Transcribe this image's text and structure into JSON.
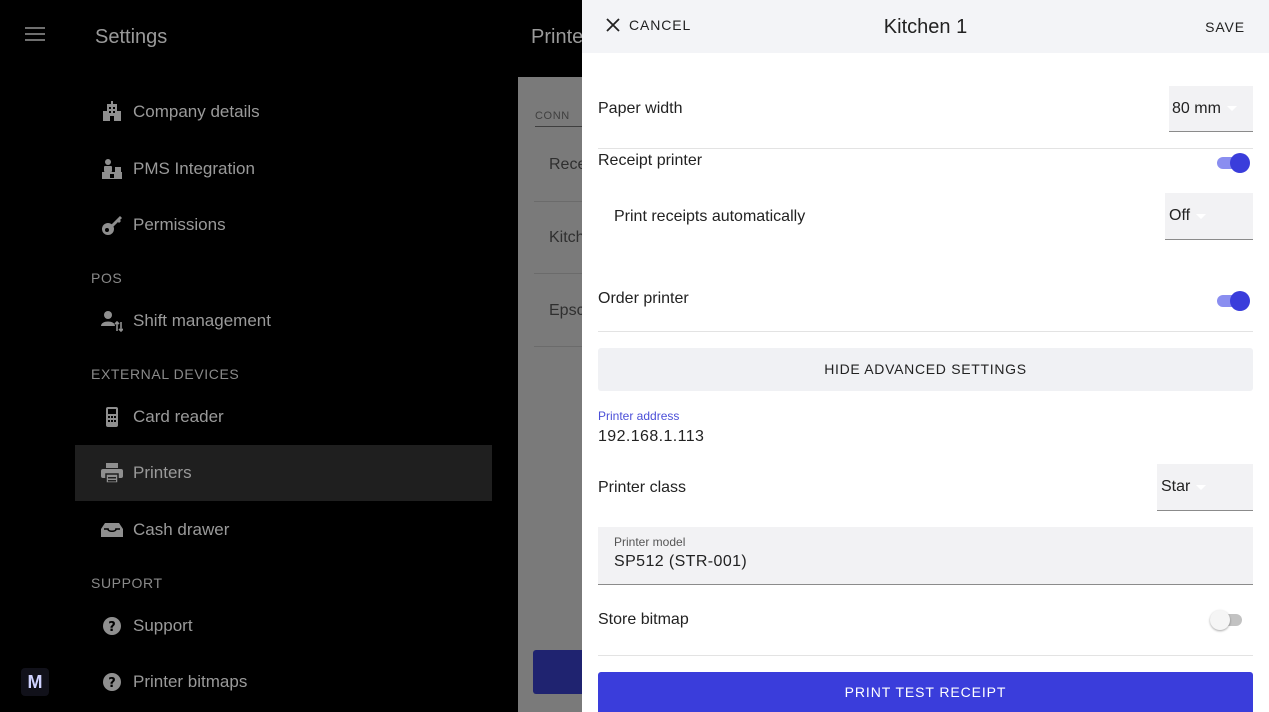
{
  "rail": {
    "logo_letter": "M"
  },
  "sidebar": {
    "title": "Settings",
    "sections": {
      "pos": "POS",
      "external_devices": "EXTERNAL DEVICES",
      "support": "SUPPORT"
    },
    "items": [
      {
        "label": "Company details",
        "icon": "building-icon"
      },
      {
        "label": "PMS Integration",
        "icon": "hotel-icon"
      },
      {
        "label": "Permissions",
        "icon": "key-icon"
      },
      {
        "label": "Shift management",
        "icon": "shift-users-icon"
      },
      {
        "label": "Card reader",
        "icon": "card-reader-icon"
      },
      {
        "label": "Printers",
        "icon": "printer-icon"
      },
      {
        "label": "Cash drawer",
        "icon": "cash-drawer-icon"
      },
      {
        "label": "Support",
        "icon": "help-icon"
      },
      {
        "label": "Printer bitmaps",
        "icon": "help-icon"
      }
    ],
    "active_item": "Printers"
  },
  "middle": {
    "title": "Printe",
    "tab": "CONN",
    "rows": [
      "Rece",
      "Kitch",
      "Epsc"
    ]
  },
  "dialog": {
    "cancel_label": "CANCEL",
    "title": "Kitchen 1",
    "save_label": "SAVE",
    "paper_width": {
      "label": "Paper width",
      "value": "80 mm"
    },
    "receipt_printer": {
      "label": "Receipt printer",
      "on": true
    },
    "print_receipts_auto": {
      "label": "Print receipts automatically",
      "value": "Off"
    },
    "order_printer": {
      "label": "Order printer",
      "on": true
    },
    "advanced_button": "HIDE ADVANCED SETTINGS",
    "printer_address": {
      "label": "Printer address",
      "value": "192.168.1.113"
    },
    "printer_class": {
      "label": "Printer class",
      "value": "Star"
    },
    "printer_model": {
      "label": "Printer model",
      "value": "SP512 (STR-001)"
    },
    "store_bitmap": {
      "label": "Store bitmap",
      "on": false
    },
    "print_test_button": "PRINT TEST RECEIPT"
  },
  "colors": {
    "accent": "#3a3ddb",
    "accent_light": "#8a8ef0",
    "float_label": "#4b4fd8",
    "sidebar_active_bg": "#1f1f1f"
  }
}
